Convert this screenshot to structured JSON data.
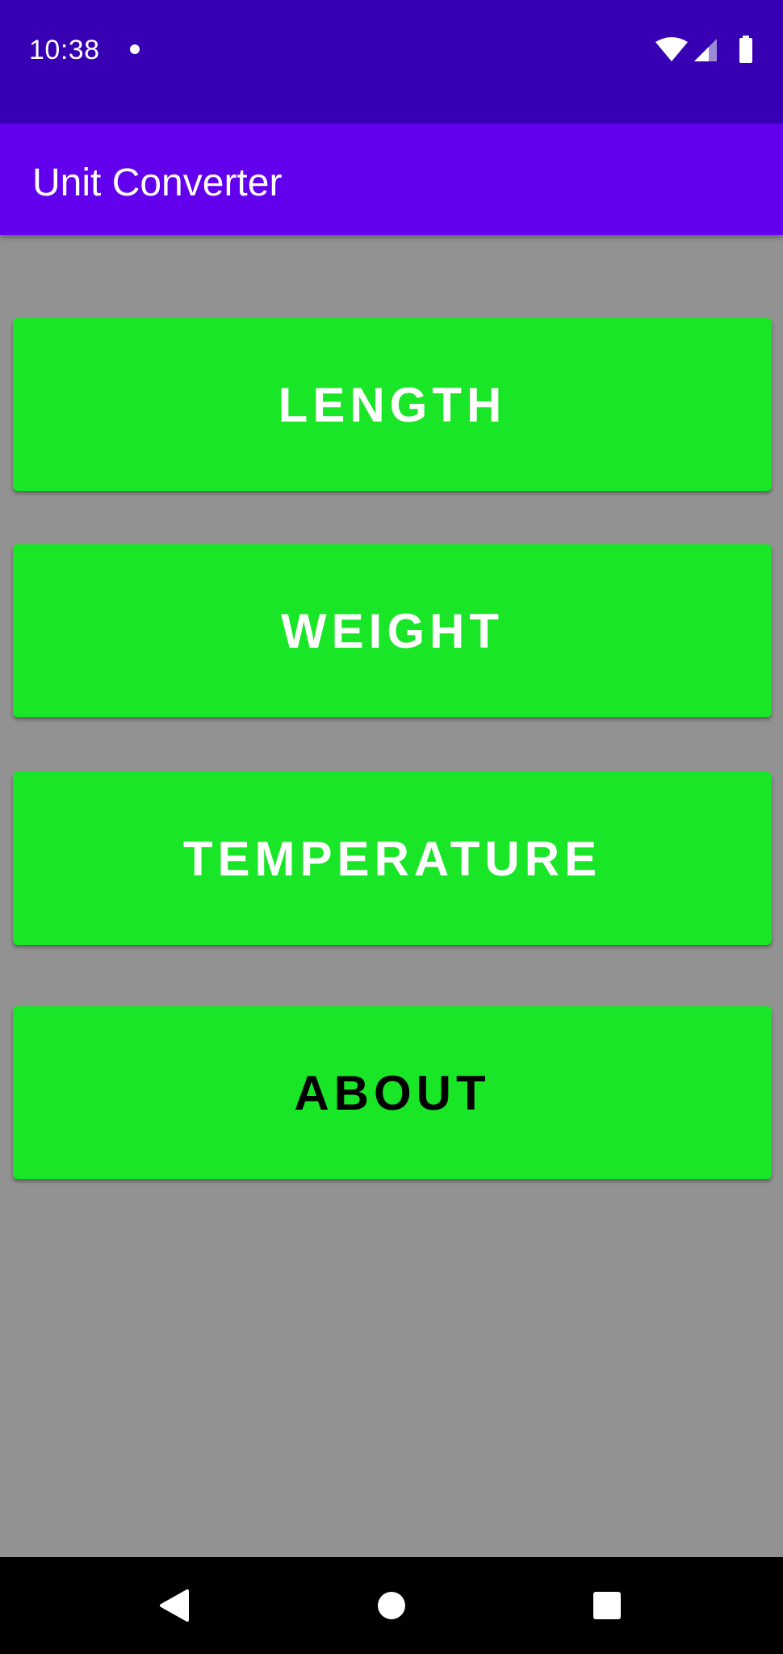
{
  "status_bar": {
    "time": "10:38",
    "icons": [
      "notification-dot-icon",
      "wifi-icon",
      "cell-signal-icon",
      "battery-icon"
    ]
  },
  "app_bar": {
    "title": "Unit Converter"
  },
  "buttons": [
    {
      "label": "LENGTH"
    },
    {
      "label": "WEIGHT"
    },
    {
      "label": "TEMPERATURE"
    },
    {
      "label": "ABOUT"
    }
  ],
  "nav_bar": {
    "icons": [
      "back-icon",
      "home-icon",
      "recents-icon"
    ]
  },
  "colors": {
    "status_bar": "#3700b3",
    "app_bar": "#6200ee",
    "background": "#929292",
    "button": "#19e626",
    "button_text_light": "#ffffff",
    "button_text_dark": "#000000",
    "nav_bar": "#000000"
  }
}
